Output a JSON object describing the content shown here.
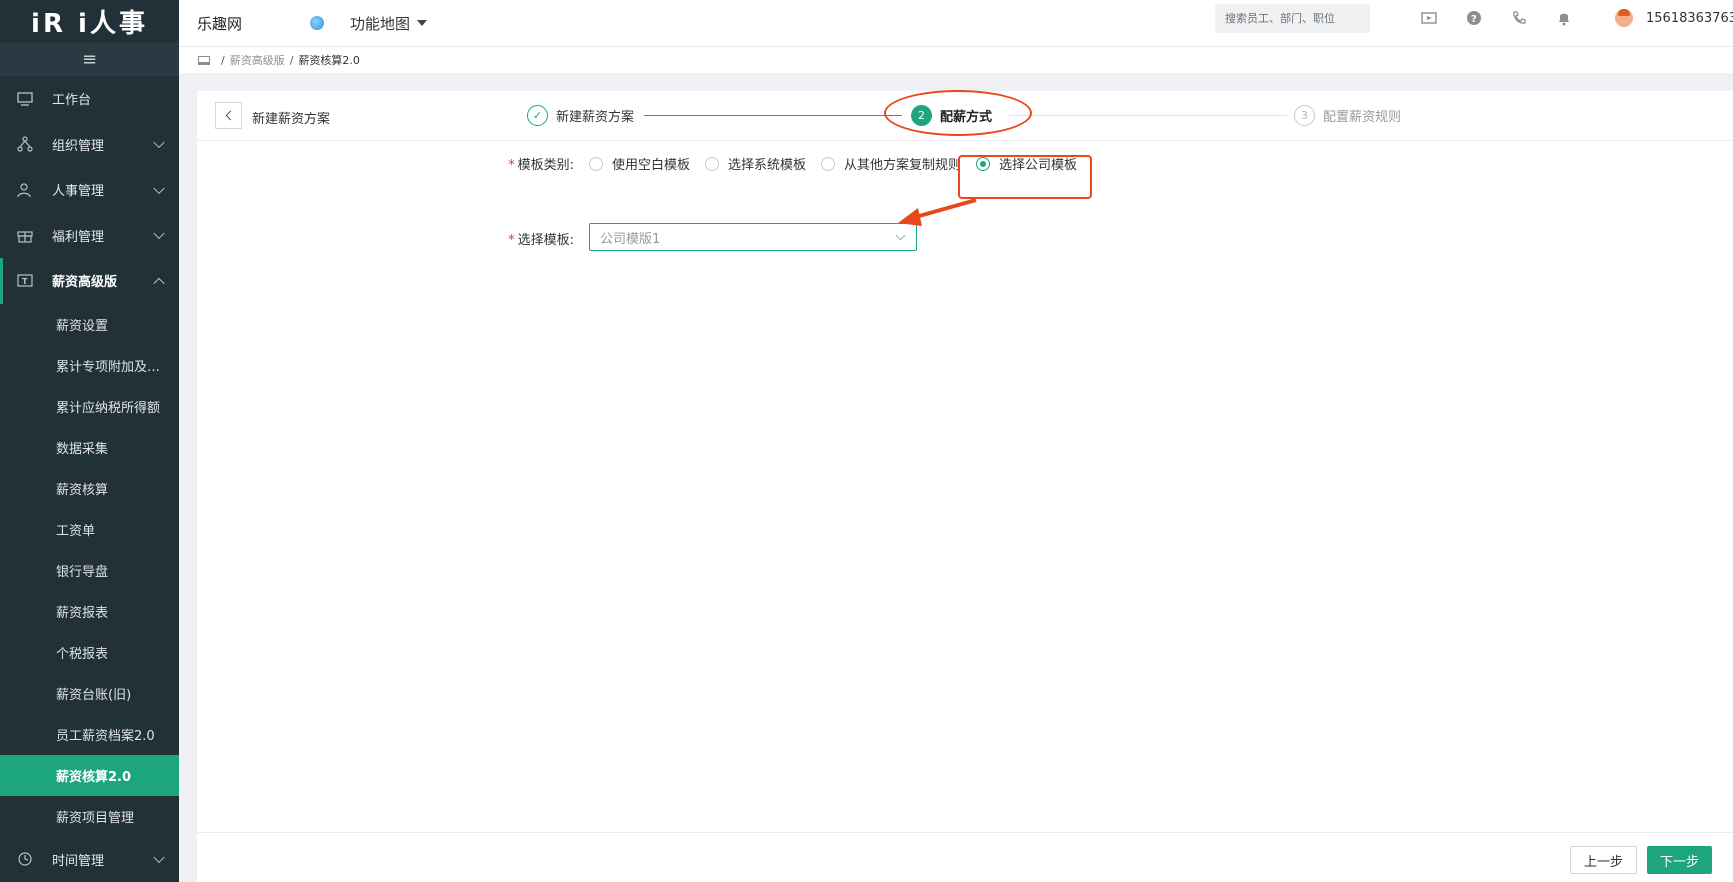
{
  "app": {
    "logo": "iR i人事",
    "company": "乐趣网",
    "function_map": "功能地图",
    "search_placeholder": "搜索员工、部门、职位",
    "phone": "15618363763"
  },
  "sidebar": {
    "menu_icon": "≡",
    "items": [
      {
        "label": "工作台",
        "icon": "monitor-icon"
      },
      {
        "label": "组织管理",
        "icon": "org-icon"
      },
      {
        "label": "人事管理",
        "icon": "person-icon"
      },
      {
        "label": "福利管理",
        "icon": "gift-icon"
      },
      {
        "label": "薪资高级版",
        "icon": "salary-icon"
      }
    ],
    "sub_items": [
      "薪资设置",
      "累计专项附加及…",
      "累计应纳税所得额",
      "数据采集",
      "薪资核算",
      "工资单",
      "银行导盘",
      "薪资报表",
      "个税报表",
      "薪资台账(旧)",
      "员工薪资档案2.0",
      "薪资核算2.0",
      "薪资项目管理"
    ],
    "bottom_item": {
      "label": "时间管理",
      "icon": "clock-icon"
    },
    "active_sub": "薪资核算2.0"
  },
  "breadcrumb": {
    "parent": "薪资高级版",
    "current": "薪资核算2.0"
  },
  "page": {
    "title": "新建薪资方案",
    "steps": [
      {
        "num": "✓",
        "label": "新建薪资方案",
        "state": "done"
      },
      {
        "num": "2",
        "label": "配薪方式",
        "state": "active"
      },
      {
        "num": "3",
        "label": "配置薪资规则",
        "state": "pending"
      }
    ],
    "template_type_label": "模板类别:",
    "template_options": [
      "使用空白模板",
      "选择系统模板",
      "从其他方案复制规则",
      "选择公司模板"
    ],
    "selected_option": "选择公司模板",
    "select_template_label": "选择模板:",
    "select_template_value": "公司模版1",
    "prev_button": "上一步",
    "next_button": "下一步"
  },
  "colors": {
    "accent": "#1da67e",
    "sidebar_bg": "#223038",
    "annotation": "#e8481c"
  }
}
